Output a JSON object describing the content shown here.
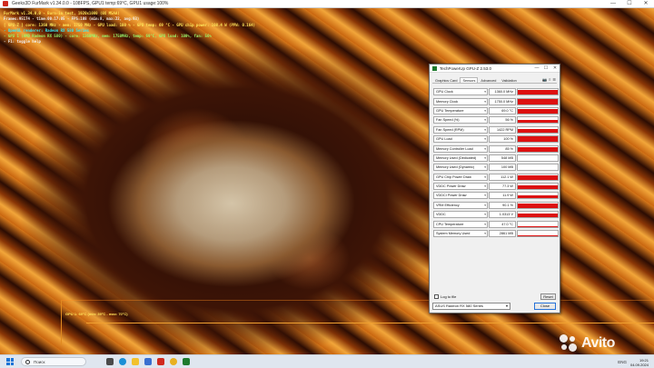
{
  "furmark": {
    "title": "Geeks3D FurMark v1.34.0.0 - 108FPS, GPU1 temp:69°C, GPU1 usage:100%",
    "window_buttons": [
      "—",
      "☐",
      "✕"
    ],
    "overlay": {
      "line1": "FurMark v1.34.0.0 - Burn-in test, 1920x1080 (0X MSAA)",
      "line2": "Frames:95174 - time:00:17:05 - FPS:108 (min:8, max:22, avg:93)",
      "line3": "[ GPU-Z ] core: 1360 MHz - mem: 1750 MHz - GPU load: 100 % - GPU temp: 69 °C - GPU chip power: 108.4 W (PPW: 0.164)",
      "line4": "- OpenGL renderer: Radeon RX 580 Series",
      "line5": "- GPU 1 (AMD Radeon RX 580) - core: 1360MHz, mem: 1750MHz, temp: 69°C, GPU load: 100%, fan: 56%",
      "line6": "- F1: toggle help"
    },
    "graph_label": "GPU 1: 69°C (min: 39°C - max: 70°C)"
  },
  "gpuz": {
    "title": "TechPowerUp GPU-Z 2.53.0",
    "title_buttons": [
      "—",
      "☐",
      "✕"
    ],
    "tabs": [
      "Graphics Card",
      "Sensors",
      "Advanced",
      "Validation"
    ],
    "tab_tools": [
      "📷",
      "≡",
      "☰"
    ],
    "sensors": [
      {
        "label": "GPU Clock",
        "value": "1360.0 MHz",
        "level": 0.9
      },
      {
        "label": "Memory Clock",
        "value": "1750.0 MHz",
        "level": 0.9
      },
      {
        "label": "GPU Temperature",
        "value": "69.0 °C",
        "level": 0.75
      },
      {
        "label": "Fan Speed (%)",
        "value": "56 %",
        "level": 0.55
      },
      {
        "label": "Fan Speed (RPM)",
        "value": "1422 RPM",
        "level": 0.6
      },
      {
        "label": "GPU Load",
        "value": "100 %",
        "level": 0.95
      },
      {
        "label": "Memory Controller Load",
        "value": "85 %",
        "level": 0.8
      },
      {
        "label": "Memory Used (Dedicated)",
        "value": "548 MB",
        "level": 0.0
      },
      {
        "label": "Memory Used (Dynamic)",
        "value": "100 MB",
        "level": 0.0
      },
      {
        "label": "GPU Chip Power Draw",
        "value": "112.1 W",
        "level": 0.8
      },
      {
        "label": "VDDC Power Draw",
        "value": "77.3 W",
        "level": 0.7
      },
      {
        "label": "VDDCI Power Draw",
        "value": "11.9 W",
        "level": 0.65
      },
      {
        "label": "VRM Efficiency",
        "value": "90.1 %",
        "level": 0.75
      },
      {
        "label": "VDDC",
        "value": "1.0313 V",
        "level": 0.7
      },
      {
        "label": "CPU Temperature",
        "value": "47.0 °C",
        "level": 0.15
      },
      {
        "label": "System Memory Used",
        "value": "2861 MB",
        "level": 0.2
      }
    ],
    "log_to_file": "Log to file",
    "reset": "Reset",
    "gpu_select": "ASUS Radeon RX 580 Series",
    "close": "Close",
    "graph_color": "#dd1010"
  },
  "watermark": "Avito",
  "taskbar": {
    "search_placeholder": "Поиск",
    "tray_language": "ENG",
    "time": "19:21",
    "date": "04.09.2024"
  }
}
